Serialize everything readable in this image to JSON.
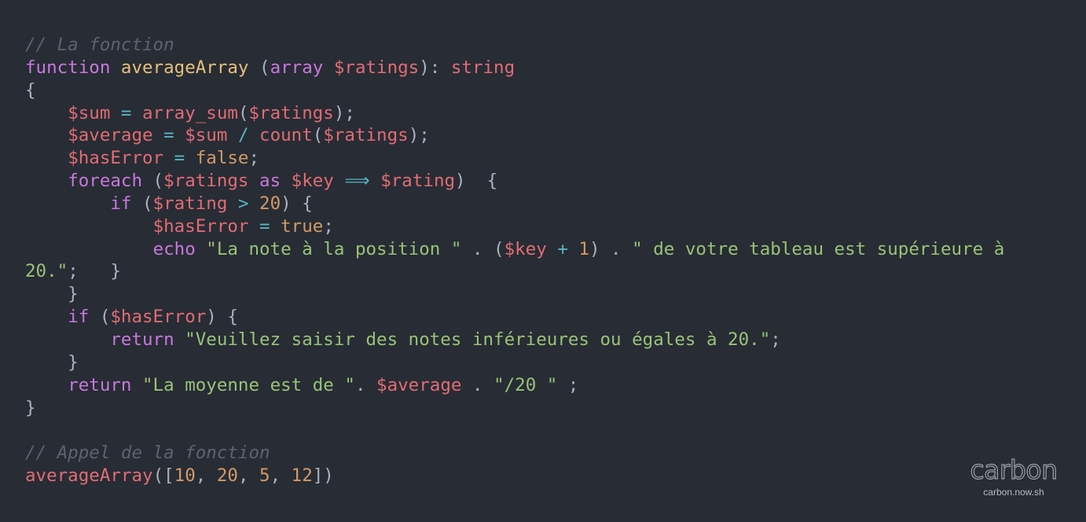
{
  "colors": {
    "background": "#282c34",
    "comment": "#5c6370",
    "keyword": "#c678dd",
    "function": "#e5c07b",
    "variable": "#e06c75",
    "operator": "#56b6c2",
    "number": "#d19a66",
    "string": "#98c379",
    "default": "#abb2bf"
  },
  "code": {
    "lines": [
      [
        {
          "type": "comment",
          "text": "// La fonction"
        }
      ],
      [
        {
          "type": "keyword",
          "text": "function"
        },
        {
          "type": "default",
          "text": " "
        },
        {
          "type": "function",
          "text": "averageArray"
        },
        {
          "type": "default",
          "text": " ("
        },
        {
          "type": "keyword",
          "text": "array"
        },
        {
          "type": "default",
          "text": " "
        },
        {
          "type": "variable",
          "text": "$ratings"
        },
        {
          "type": "default",
          "text": "): "
        },
        {
          "type": "type",
          "text": "string"
        }
      ],
      [
        {
          "type": "default",
          "text": "{"
        }
      ],
      [
        {
          "type": "default",
          "text": "    "
        },
        {
          "type": "variable",
          "text": "$sum"
        },
        {
          "type": "default",
          "text": " "
        },
        {
          "type": "operator",
          "text": "="
        },
        {
          "type": "default",
          "text": " "
        },
        {
          "type": "call",
          "text": "array_sum"
        },
        {
          "type": "default",
          "text": "("
        },
        {
          "type": "variable",
          "text": "$ratings"
        },
        {
          "type": "default",
          "text": ");"
        }
      ],
      [
        {
          "type": "default",
          "text": "    "
        },
        {
          "type": "variable",
          "text": "$average"
        },
        {
          "type": "default",
          "text": " "
        },
        {
          "type": "operator",
          "text": "="
        },
        {
          "type": "default",
          "text": " "
        },
        {
          "type": "variable",
          "text": "$sum"
        },
        {
          "type": "default",
          "text": " "
        },
        {
          "type": "operator",
          "text": "/"
        },
        {
          "type": "default",
          "text": " "
        },
        {
          "type": "call",
          "text": "count"
        },
        {
          "type": "default",
          "text": "("
        },
        {
          "type": "variable",
          "text": "$ratings"
        },
        {
          "type": "default",
          "text": ");"
        }
      ],
      [
        {
          "type": "default",
          "text": "    "
        },
        {
          "type": "variable",
          "text": "$hasError"
        },
        {
          "type": "default",
          "text": " "
        },
        {
          "type": "operator",
          "text": "="
        },
        {
          "type": "default",
          "text": " "
        },
        {
          "type": "boolean",
          "text": "false"
        },
        {
          "type": "default",
          "text": ";"
        }
      ],
      [
        {
          "type": "default",
          "text": "    "
        },
        {
          "type": "keyword",
          "text": "foreach"
        },
        {
          "type": "default",
          "text": " ("
        },
        {
          "type": "variable",
          "text": "$ratings"
        },
        {
          "type": "default",
          "text": " "
        },
        {
          "type": "keyword",
          "text": "as"
        },
        {
          "type": "default",
          "text": " "
        },
        {
          "type": "variable",
          "text": "$key"
        },
        {
          "type": "default",
          "text": " "
        },
        {
          "type": "operator",
          "text": "⟹"
        },
        {
          "type": "default",
          "text": " "
        },
        {
          "type": "variable",
          "text": "$rating"
        },
        {
          "type": "default",
          "text": ")  {"
        }
      ],
      [
        {
          "type": "default",
          "text": "        "
        },
        {
          "type": "keyword",
          "text": "if"
        },
        {
          "type": "default",
          "text": " ("
        },
        {
          "type": "variable",
          "text": "$rating"
        },
        {
          "type": "default",
          "text": " "
        },
        {
          "type": "operator",
          "text": ">"
        },
        {
          "type": "default",
          "text": " "
        },
        {
          "type": "number",
          "text": "20"
        },
        {
          "type": "default",
          "text": ") {"
        }
      ],
      [
        {
          "type": "default",
          "text": "            "
        },
        {
          "type": "variable",
          "text": "$hasError"
        },
        {
          "type": "default",
          "text": " "
        },
        {
          "type": "operator",
          "text": "="
        },
        {
          "type": "default",
          "text": " "
        },
        {
          "type": "boolean",
          "text": "true"
        },
        {
          "type": "default",
          "text": ";"
        }
      ],
      [
        {
          "type": "default",
          "text": "            "
        },
        {
          "type": "keyword",
          "text": "echo"
        },
        {
          "type": "default",
          "text": " "
        },
        {
          "type": "string",
          "text": "\"La note à la position \""
        },
        {
          "type": "default",
          "text": " . ("
        },
        {
          "type": "variable",
          "text": "$key"
        },
        {
          "type": "default",
          "text": " "
        },
        {
          "type": "operator",
          "text": "+"
        },
        {
          "type": "default",
          "text": " "
        },
        {
          "type": "number",
          "text": "1"
        },
        {
          "type": "default",
          "text": ") . "
        },
        {
          "type": "string",
          "text": "\" de votre tableau est supérieure à"
        }
      ],
      [
        {
          "type": "string",
          "text": "20.\""
        },
        {
          "type": "default",
          "text": ";   }"
        }
      ],
      [
        {
          "type": "default",
          "text": "    }"
        }
      ],
      [
        {
          "type": "default",
          "text": "    "
        },
        {
          "type": "keyword",
          "text": "if"
        },
        {
          "type": "default",
          "text": " ("
        },
        {
          "type": "variable",
          "text": "$hasError"
        },
        {
          "type": "default",
          "text": ") {"
        }
      ],
      [
        {
          "type": "default",
          "text": "        "
        },
        {
          "type": "keyword",
          "text": "return"
        },
        {
          "type": "default",
          "text": " "
        },
        {
          "type": "string",
          "text": "\"Veuillez saisir des notes inférieures ou égales à 20.\""
        },
        {
          "type": "default",
          "text": ";"
        }
      ],
      [
        {
          "type": "default",
          "text": "    }"
        }
      ],
      [
        {
          "type": "default",
          "text": "    "
        },
        {
          "type": "keyword",
          "text": "return"
        },
        {
          "type": "default",
          "text": " "
        },
        {
          "type": "string",
          "text": "\"La moyenne est de \""
        },
        {
          "type": "default",
          "text": ". "
        },
        {
          "type": "variable",
          "text": "$average"
        },
        {
          "type": "default",
          "text": " . "
        },
        {
          "type": "string",
          "text": "\"/20 \""
        },
        {
          "type": "default",
          "text": " ;"
        }
      ],
      [
        {
          "type": "default",
          "text": "}"
        }
      ],
      [
        {
          "type": "default",
          "text": ""
        }
      ],
      [
        {
          "type": "comment",
          "text": "// Appel de la fonction"
        }
      ],
      [
        {
          "type": "call",
          "text": "averageArray"
        },
        {
          "type": "default",
          "text": "(["
        },
        {
          "type": "number",
          "text": "10"
        },
        {
          "type": "default",
          "text": ", "
        },
        {
          "type": "number",
          "text": "20"
        },
        {
          "type": "default",
          "text": ", "
        },
        {
          "type": "number",
          "text": "5"
        },
        {
          "type": "default",
          "text": ", "
        },
        {
          "type": "number",
          "text": "12"
        },
        {
          "type": "default",
          "text": "])"
        }
      ]
    ]
  },
  "watermark": {
    "logo": "carbon",
    "url": "carbon.now.sh"
  }
}
